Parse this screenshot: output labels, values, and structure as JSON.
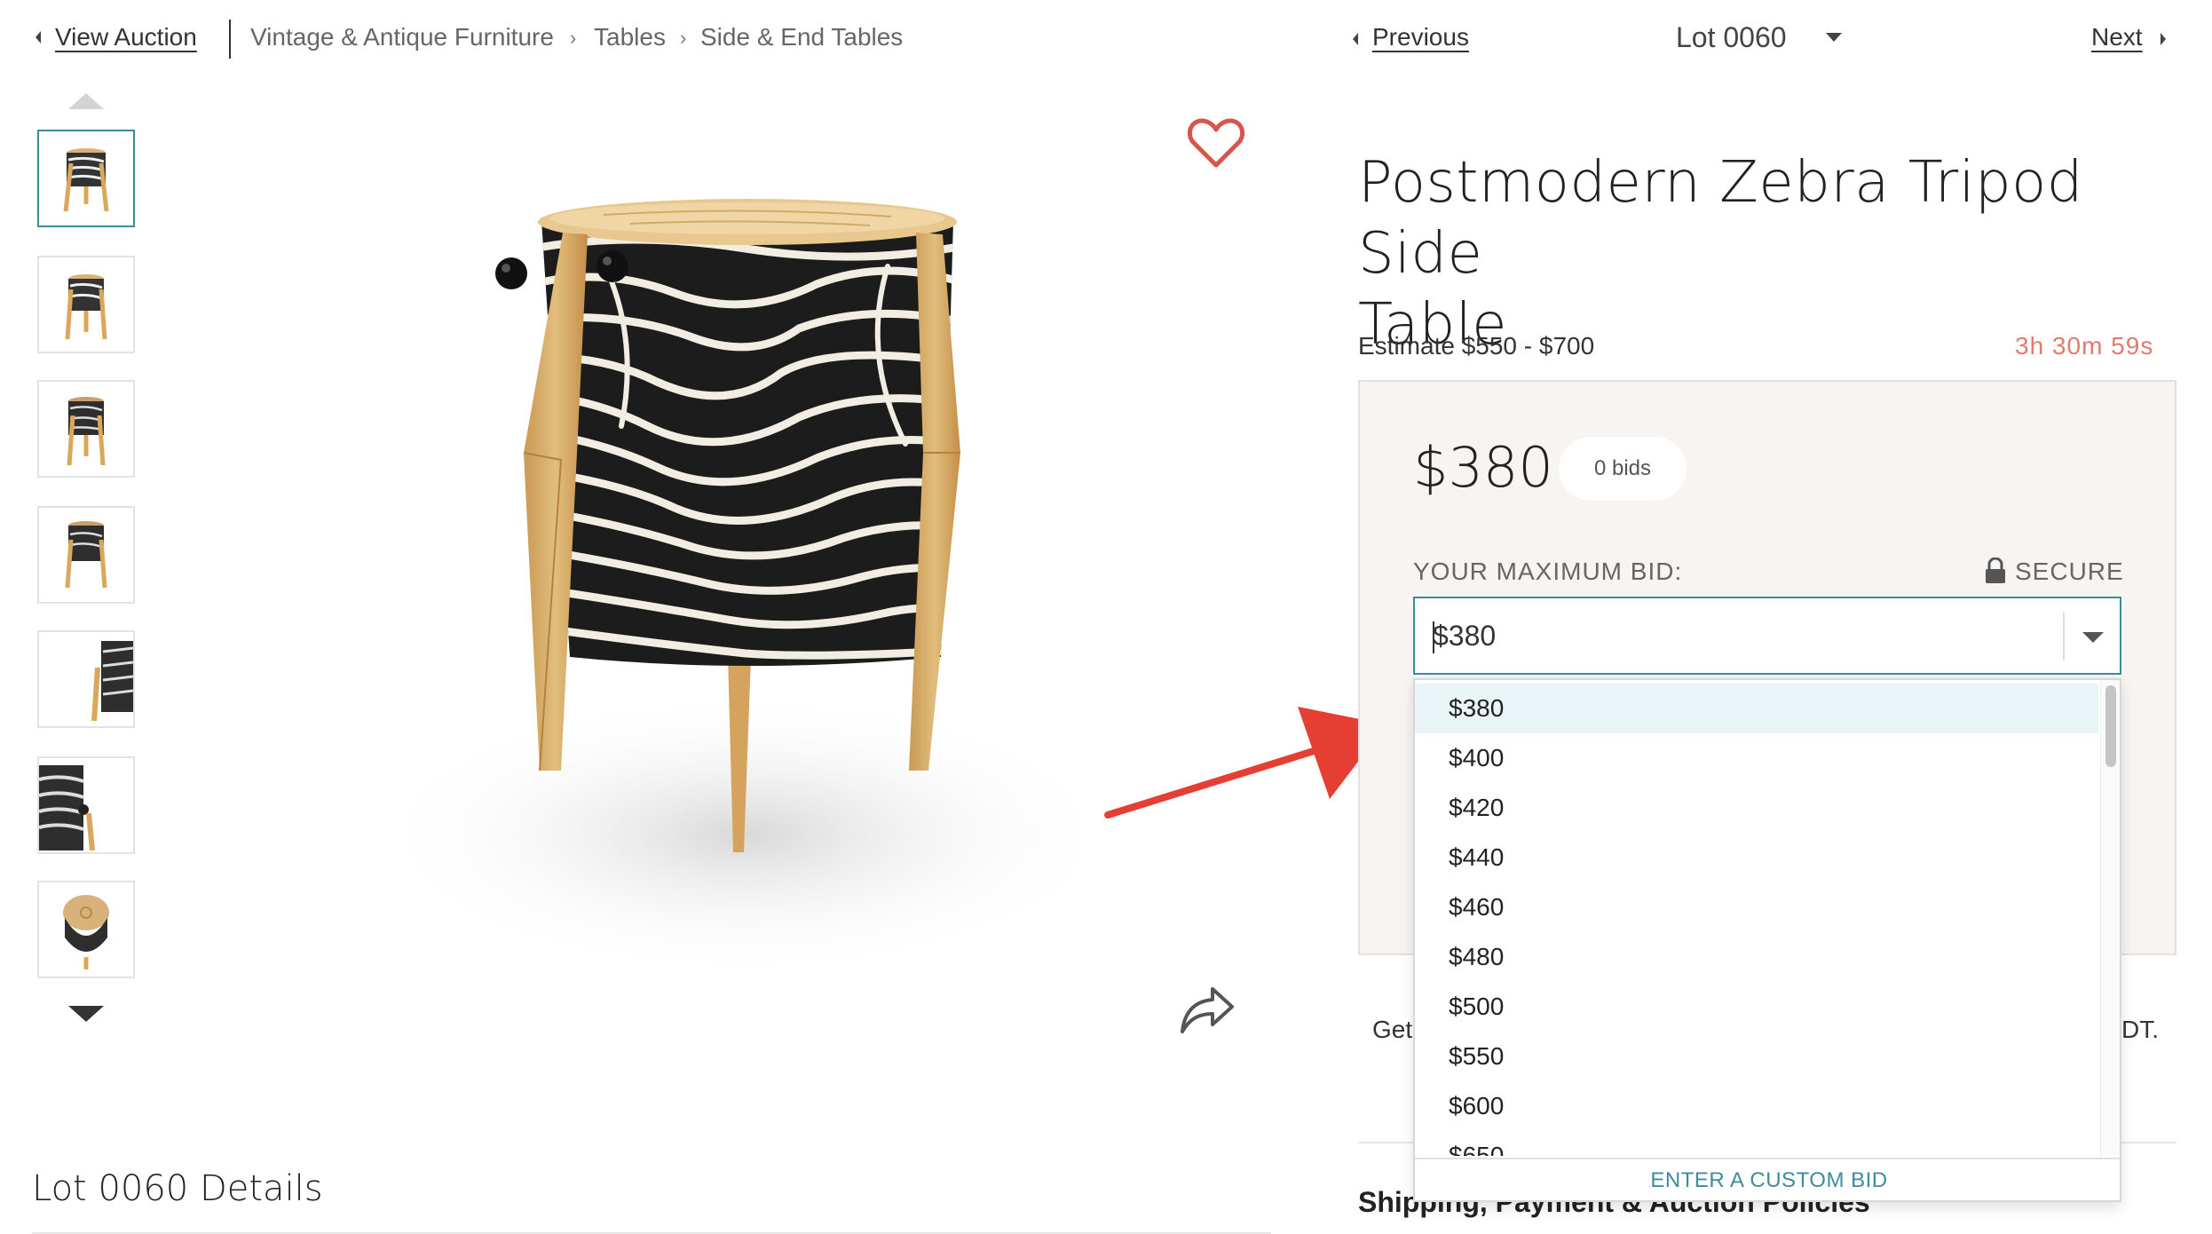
{
  "nav": {
    "view_auction": "View Auction",
    "breadcrumbs": [
      "Vintage & Antique Furniture",
      "Tables",
      "Side & End Tables"
    ],
    "previous": "Previous",
    "lot_select": "Lot 0060",
    "next": "Next"
  },
  "lot": {
    "title_line1": "Postmodern Zebra Tripod Side",
    "title_line2": "Table",
    "estimate": "Estimate $550 - $700",
    "time_left": "3h 30m 59s"
  },
  "bidding": {
    "current_price": "$380",
    "bids_count": "0 bids",
    "max_bid_label": "YOUR MAXIMUM BID:",
    "secure_label": "SECURE",
    "input_value": "$380",
    "options": [
      "$380",
      "$400",
      "$420",
      "$440",
      "$460",
      "$480",
      "$500",
      "$550",
      "$600",
      "$650"
    ],
    "selected_option": "$380",
    "custom_bid": "ENTER A CUSTOM BID"
  },
  "partial_text": {
    "get_prefix": "Get",
    "dt_suffix": "DT.",
    "shipping_heading": "Shipping, Payment & Auction Policies"
  },
  "details_heading": "Lot 0060 Details",
  "colors": {
    "accent": "#3b8d9c",
    "timer": "#e17b6f",
    "heart": "#d9534f",
    "arrow": "#e53f33",
    "panel_bg": "#f7f4f2"
  },
  "icons": [
    "chevron-left-icon",
    "chevron-right-icon",
    "caret-down-icon",
    "heart-icon",
    "share-icon",
    "lock-icon",
    "arrow-up-icon",
    "arrow-down-icon"
  ]
}
